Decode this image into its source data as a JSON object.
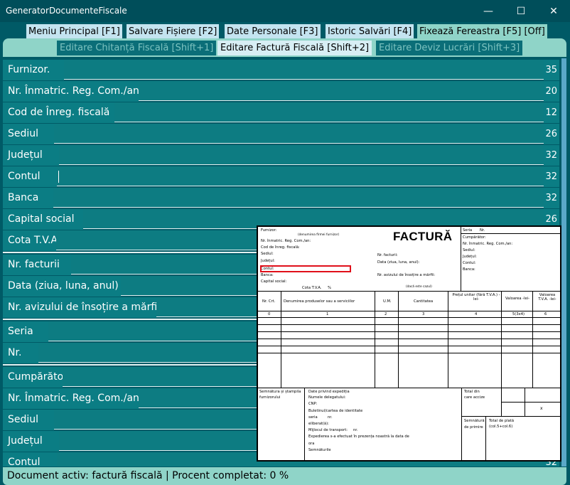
{
  "window": {
    "title": "GeneratorDocumenteFiscale",
    "minimize_glyph": "—",
    "maximize_glyph": "☐",
    "close_glyph": "✕"
  },
  "menu": {
    "items": [
      {
        "label": "Meniu Principal [F1]"
      },
      {
        "label": "Salvare Fișiere [F2]"
      },
      {
        "label": "Date Personale [F3]"
      },
      {
        "label": "Istoric Salvări [F4]"
      },
      {
        "label": "Fixează Fereastra [F5] [Off]"
      }
    ]
  },
  "tabs": [
    {
      "label": "Editare Chitanță Fiscală [Shift+1]",
      "active": false
    },
    {
      "label": "Editare Factură Fiscală [Shift+2]",
      "active": true
    },
    {
      "label": "Editare Deviz Lucrări [Shift+3]",
      "active": false
    }
  ],
  "fields": [
    {
      "label": "Furnizor.",
      "value": "",
      "remaining": "35"
    },
    {
      "label": "Nr. Înmatric. Reg. Com./an",
      "value": "",
      "remaining": "20"
    },
    {
      "label": "Cod de Înreg. fiscală",
      "value": "",
      "remaining": "12"
    },
    {
      "label": "Sediul",
      "value": "",
      "remaining": "26"
    },
    {
      "label": "Județul",
      "value": "",
      "remaining": "32"
    },
    {
      "label": "Contul",
      "value": "",
      "remaining": "32"
    },
    {
      "label": "Banca",
      "value": "",
      "remaining": "32"
    },
    {
      "label": "Capital social",
      "value": "",
      "remaining": "26"
    },
    {
      "label": "Cota T.V.A.",
      "value": "",
      "remaining": ""
    },
    {
      "label": "Nr. facturii",
      "value": "",
      "remaining": ""
    },
    {
      "label": "Data (ziua, luna, anul)",
      "value": "",
      "remaining": ""
    },
    {
      "label": "Nr. avizului de însoțire a mărfii",
      "value": "",
      "remaining": ""
    },
    {
      "label": "Seria",
      "value": "",
      "remaining": ""
    },
    {
      "label": "Nr.",
      "value": "",
      "remaining": ""
    },
    {
      "label": "Cumpărător",
      "value": "",
      "remaining": ""
    },
    {
      "label": "Nr. Înmatric. Reg. Com./an",
      "value": "",
      "remaining": ""
    },
    {
      "label": "Sediul",
      "value": "",
      "remaining": ""
    },
    {
      "label": "Județul",
      "value": "",
      "remaining": ""
    },
    {
      "label": "Contul",
      "value": "",
      "remaining": "32"
    }
  ],
  "preview": {
    "title": "FACTURĂ",
    "left_header": [
      "Furnizor:",
      "(denumirea firmei furnizor)",
      "Nr. înmatric. Reg. Com./an:",
      "Cod de înreg. fiscală:",
      "Sediul:",
      "Județul:",
      "Contul:",
      "Banca:",
      "Capital social:"
    ],
    "cota_tva": "Cota T.V.A.",
    "percent": "%",
    "middle_header": [
      "Nr. facturii:",
      "Data (ziua, luna, anul):",
      "Nr. avizului de însoțire a mărfii:",
      "(dacă este cazul)"
    ],
    "right_header": [
      "Seria",
      "Nr.",
      "Cumpărător:",
      "Nr. înmatric. Reg. Com./an:",
      "Sediul:",
      "Județul:",
      "Contul:",
      "Banca:"
    ],
    "columns": [
      "Nr. Crt.",
      "Denumirea produselor sau a serviciilor",
      "U.M.",
      "Cantitatea",
      "Prețul unitar (fără T.V.A.) -lei-",
      "Valoarea -lei-",
      "Valoarea T.V.A. -lei-"
    ],
    "column_numbers": [
      "0",
      "1",
      "2",
      "3",
      "4",
      "5(3x4)",
      "6"
    ],
    "footer_left": [
      "Semnătura și ștampila",
      "furnizorului"
    ],
    "footer_middle": [
      "Date privind expediția",
      "Numele delegatului:",
      "CNP:",
      "Buletinul/cartea de identitate",
      "seria",
      "nr.",
      "eliberat(ă):",
      "Mijlocul de transport:",
      "nr.",
      "Expedierea s-a efectuat în prezența noastră la data de",
      "ora",
      "Semnăturile"
    ],
    "footer_total": [
      "Total din",
      "care accize"
    ],
    "footer_x": "x",
    "footer_sign": [
      "Semnătură",
      "de primire"
    ],
    "footer_pay": [
      "Total de plată",
      "(col.5+col.6)"
    ]
  },
  "status": {
    "text": "Document activ: factură fiscală | Procent completat: 0 %",
    "percent_complete": 0
  }
}
